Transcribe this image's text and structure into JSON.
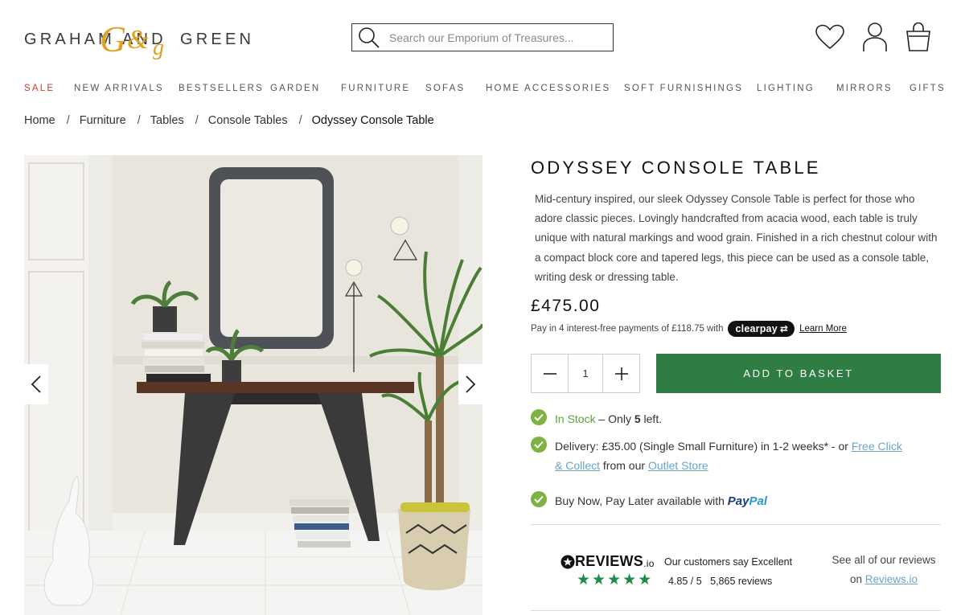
{
  "header": {
    "logo": {
      "word1": "GRAHAM",
      "word2": "AND",
      "word3": "GREEN",
      "mark": "G&g"
    },
    "search": {
      "placeholder": "Search our Emporium of Treasures..."
    },
    "icons": [
      "heart-icon",
      "user-icon",
      "shopping-bag-icon"
    ]
  },
  "nav": {
    "items": [
      "SALE",
      "NEW ARRIVALS",
      "BESTSELLERS",
      "GARDEN",
      "FURNITURE",
      "SOFAS",
      "HOME ACCESSORIES",
      "SOFT FURNISHINGS",
      "LIGHTING",
      "MIRRORS",
      "GIFTS"
    ]
  },
  "breadcrumb": {
    "items": [
      "Home",
      "Furniture",
      "Tables",
      "Console Tables",
      "Odyssey Console Table"
    ],
    "separator": "/"
  },
  "product": {
    "title": "ODYSSEY CONSOLE TABLE",
    "description": "Mid-century inspired, our sleek Odyssey Console Table is perfect for those who adore classic pieces. Lovingly handcrafted from acacia wood, each table is truly unique with natural markings and wood grain. Finished in a rich chestnut colour with a compact block core and tapered legs, this piece can be used as a console table, writing desk or dressing table.",
    "price": "£475.00",
    "clearpay": {
      "text": "Pay in 4 interest-free payments of £118.75 with",
      "badge": "clearpay",
      "learn_more": "Learn More"
    },
    "quantity": "1",
    "add_to_basket": "ADD TO BASKET",
    "stock": {
      "status": "In Stock",
      "dash": " – Only ",
      "count": "5",
      "suffix": " left."
    },
    "delivery": {
      "text": "Delivery: £35.00 (Single Small Furniture) in 1-2 weeks* - or ",
      "link1": "Free Click & Collect",
      "middle": " from our ",
      "link2": "Outlet Store"
    },
    "bnpl": {
      "text": "Buy Now, Pay Later available with ",
      "brand_part1": "Pay",
      "brand_part2": "Pal"
    }
  },
  "reviews": {
    "logo": "REVIEWS",
    "logo_suffix": ".io",
    "summary": "Our customers say Excellent",
    "score": "4.85 / 5",
    "count": "5,865 reviews",
    "rating": 4.85,
    "see_all": "See all of our reviews",
    "on": "on ",
    "link": "Reviews.io"
  },
  "colors": {
    "accent_green": "#2f7d45",
    "check_green": "#7cb342",
    "sale_red": "#d03a2a",
    "link_blue": "#6aa4c8",
    "logo_gold": "#e0a020"
  }
}
